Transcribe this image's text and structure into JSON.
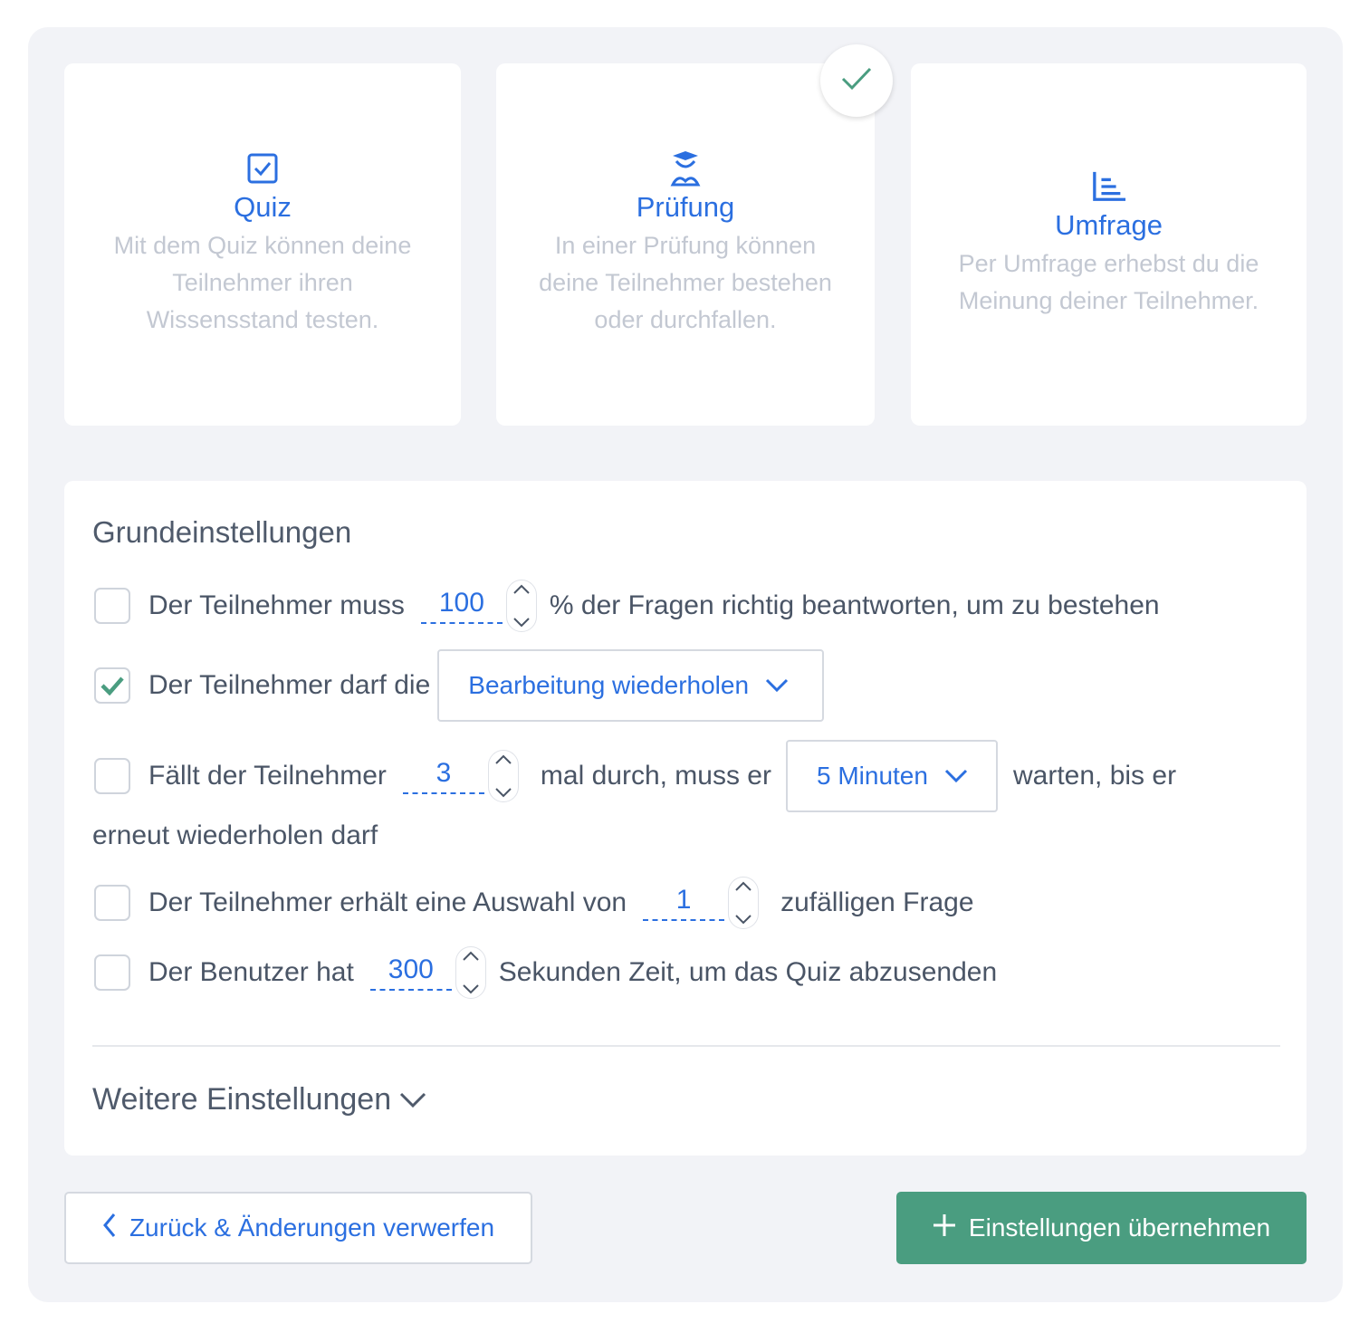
{
  "types": {
    "quiz": {
      "title": "Quiz",
      "desc_lines": [
        "Mit dem Quiz können deine",
        "Teilnehmer ihren",
        "Wissensstand testen."
      ]
    },
    "exam": {
      "title": "Prüfung",
      "desc_lines": [
        "In einer Prüfung können",
        "deine Teilnehmer bestehen",
        "oder durchfallen."
      ],
      "selected": true
    },
    "survey": {
      "title": "Umfrage",
      "desc_lines": [
        "Per Umfrage erhebst du die",
        "Meinung deiner Teilnehmer."
      ]
    }
  },
  "settings": {
    "heading": "Grundeinstellungen",
    "pass": {
      "before": "Der Teilnehmer muss",
      "value": "100",
      "after": "% der Fragen richtig beantworten, um zu bestehen",
      "checked": false
    },
    "repeat": {
      "before": "Der Teilnehmer darf die",
      "select": "Bearbeitung wiederholen",
      "checked": true
    },
    "fail": {
      "before": "Fällt der Teilnehmer",
      "value": "3",
      "middle": "mal durch, muss er",
      "select": "5 Minuten",
      "after": "warten, bis er",
      "wrap": "erneut wiederholen darf",
      "checked": false
    },
    "random": {
      "before": "Der Teilnehmer erhält eine Auswahl von",
      "value": "1",
      "after": "zufälligen Frage",
      "checked": false
    },
    "timer": {
      "before": "Der Benutzer hat",
      "value": "300",
      "after": "Sekunden Zeit, um das Quiz abzusenden",
      "checked": false
    },
    "more": "Weitere Einstellungen"
  },
  "buttons": {
    "back": "Zurück & Änderungen verwerfen",
    "apply": "Einstellungen übernehmen"
  },
  "colors": {
    "accent": "#2b6fe0",
    "success": "#4a9d80",
    "panel_bg": "#f2f3f7"
  },
  "icons": {
    "quiz": "checkbox-icon",
    "exam": "graduate-icon",
    "survey": "bar-list-icon",
    "badge": "checkmark-icon"
  }
}
